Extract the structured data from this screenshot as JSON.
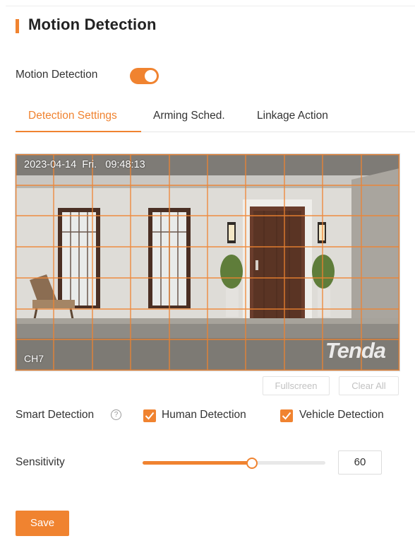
{
  "header": {
    "title": "Motion Detection"
  },
  "motion_detection": {
    "label": "Motion Detection",
    "enabled": true
  },
  "tabs": [
    {
      "label": "Detection Settings",
      "active": true
    },
    {
      "label": "Arming Sched.",
      "active": false
    },
    {
      "label": "Linkage Action",
      "active": false
    }
  ],
  "video": {
    "timestamp": "2023-04-14  Fri.   09:48:13",
    "channel": "CH7",
    "watermark": "Tenda",
    "grid": {
      "columns": 10,
      "rows": 7
    }
  },
  "actions": {
    "fullscreen": "Fullscreen",
    "clear_all": "Clear All"
  },
  "smart_detection": {
    "label": "Smart Detection",
    "help_icon": "?",
    "options": [
      {
        "label": "Human Detection",
        "checked": true
      },
      {
        "label": "Vehicle Detection",
        "checked": true
      }
    ]
  },
  "sensitivity": {
    "label": "Sensitivity",
    "value": "60",
    "fraction": 0.6
  },
  "save_label": "Save",
  "colors": {
    "accent": "#f08330",
    "text": "#333333",
    "muted": "#c2c2c2"
  }
}
